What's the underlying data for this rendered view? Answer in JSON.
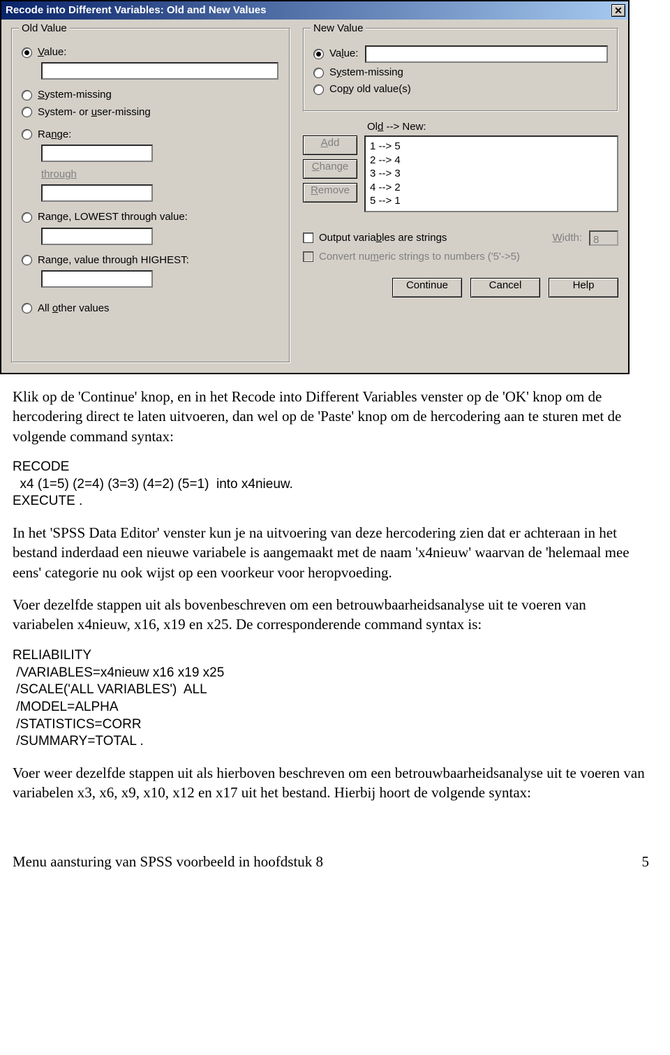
{
  "dialog": {
    "title": "Recode into Different Variables: Old and New Values",
    "old_group": {
      "legend": "Old Value",
      "value_label": "Value:",
      "system_missing": "System-missing",
      "system_user_missing": "System- or user-missing",
      "range_label": "Range:",
      "through": "through",
      "range_lowest": "Range, LOWEST through value:",
      "range_highest": "Range, value through HIGHEST:",
      "all_other": "All other values"
    },
    "new_group": {
      "legend": "New Value",
      "value_label": "Value:",
      "system_missing": "System-missing",
      "copy_old": "Copy old value(s)"
    },
    "buttons": {
      "add": "Add",
      "change": "Change",
      "remove": "Remove"
    },
    "old_new_label": "Old --> New:",
    "mappings": [
      "1 --> 5",
      "2 --> 4",
      "3 --> 3",
      "4 --> 2",
      "5 --> 1"
    ],
    "out_strings": "Output variables are strings",
    "width_label": "Width:",
    "width_value": "8",
    "convert": "Convert numeric strings to numbers ('5'->5)",
    "cont": "Continue",
    "cancel": "Cancel",
    "help": "Help"
  },
  "doc": {
    "p1": "Klik op de 'Continue' knop, en in het Recode into Different Variables venster op de 'OK' knop om de hercodering direct te laten uitvoeren, dan wel op de 'Paste' knop om de hercodering aan te sturen met de volgende command syntax:",
    "code1_l1": "RECODE",
    "code1_l2": "  x4 (1=5) (2=4) (3=3) (4=2) (5=1)  into x4nieuw.",
    "code1_l3": "EXECUTE .",
    "p2": "In het 'SPSS Data Editor' venster kun je na uitvoering van deze hercodering zien dat er achteraan in het bestand inderdaad een nieuwe variabele is aangemaakt met de naam 'x4nieuw' waarvan de 'helemaal mee eens' categorie nu ook wijst op een voorkeur voor heropvoeding.",
    "p3": "Voer dezelfde stappen uit als bovenbeschreven om een betrouwbaarheidsanalyse uit te voeren van variabelen x4nieuw, x16, x19 en x25. De corresponderende command syntax is:",
    "code2_l1": "RELIABILITY",
    "code2_l2": " /VARIABLES=x4nieuw x16 x19 x25",
    "code2_l3": " /SCALE('ALL VARIABLES')  ALL",
    "code2_l4": " /MODEL=ALPHA",
    "code2_l5": " /STATISTICS=CORR",
    "code2_l6": " /SUMMARY=TOTAL .",
    "p4": "Voer weer dezelfde stappen uit als hierboven beschreven om een betrouwbaarheidsanalyse uit te voeren van variabelen x3, x6, x9, x10, x12 en x17 uit het bestand. Hierbij hoort de volgende syntax:",
    "footer_left": "Menu aansturing van SPSS voorbeeld in hoofdstuk 8",
    "footer_right": "5"
  }
}
